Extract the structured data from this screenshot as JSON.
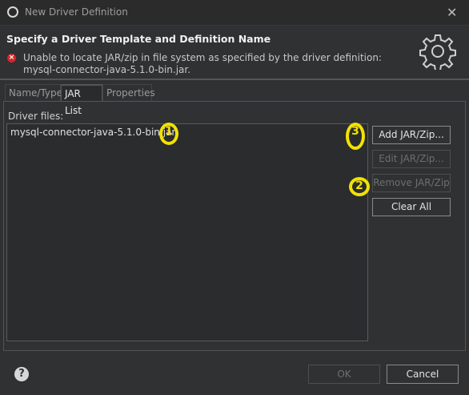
{
  "window": {
    "title": "New Driver Definition",
    "close_glyph": "✕"
  },
  "header": {
    "heading": "Specify a Driver Template and Definition Name",
    "error_message": "Unable to locate JAR/zip in file system as specified by the driver definition: mysql-connector-java-5.1.0-bin.jar.",
    "error_icon": "error-icon",
    "banner_icon": "gear-icon"
  },
  "tabs": [
    {
      "label": "Name/Type",
      "active": false
    },
    {
      "label": "JAR List",
      "active": true
    },
    {
      "label": "Properties",
      "active": false
    }
  ],
  "jar_list": {
    "label": "Driver files:",
    "files": [
      "mysql-connector-java-5.1.0-bin.jar"
    ]
  },
  "buttons": {
    "add": "Add JAR/Zip...",
    "edit": "Edit JAR/Zip...",
    "remove": "Remove JAR/Zip",
    "clear": "Clear All"
  },
  "annotations": [
    "1",
    "2",
    "3"
  ],
  "footer": {
    "help": "?",
    "ok": "OK",
    "cancel": "Cancel"
  },
  "colors": {
    "accent_tab": "#e9c200",
    "annotation": "#f2e200",
    "error": "#d4262d"
  }
}
